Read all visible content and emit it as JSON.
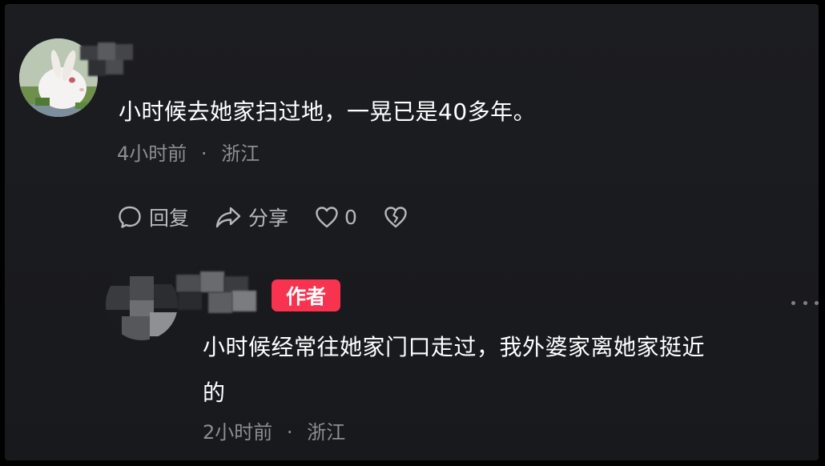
{
  "comment": {
    "text": "小时候去她家扫过地，一晃已是40多年。",
    "time": "4小时前",
    "separator": "·",
    "location": "浙江",
    "actions": {
      "reply_label": "回复",
      "share_label": "分享",
      "like_count": "0"
    }
  },
  "reply": {
    "badge": "作者",
    "text_line1": "小时候经常往她家门口走过，我外婆家离她家挺近",
    "text_line2": "的",
    "time": "2小时前",
    "separator": "·",
    "location": "浙江"
  },
  "icons": {
    "reply": "comment-bubble-icon",
    "share": "share-arrow-icon",
    "like": "heart-icon",
    "dislike": "broken-heart-icon",
    "more": "more-dots-icon"
  },
  "colors": {
    "background": "#1a1b1f",
    "text": "#ffffff",
    "meta": "#8d8e93",
    "author_badge": "#f7334f"
  }
}
